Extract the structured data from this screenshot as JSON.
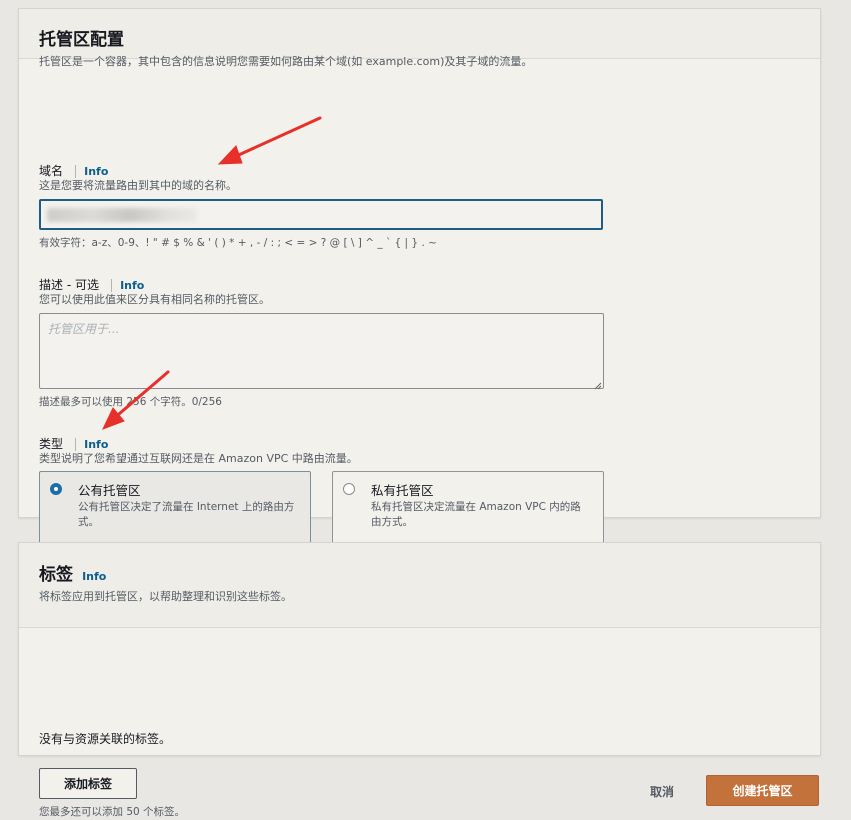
{
  "hosted_zone": {
    "title": "托管区配置",
    "description": "托管区是一个容器，其中包含的信息说明您需要如何路由某个域(如 example.com)及其子域的流量。",
    "domain": {
      "label": "域名",
      "info": "Info",
      "description": "这是您要将流量路由到其中的域的名称。",
      "valid_chars": "有效字符：a-z、0-9、! \" # $ % & ' ( ) * + , - / : ; < = > ? @ [ \\ ] ^ _ ` { | } . ~"
    },
    "description_field": {
      "label": "描述 - ",
      "optional": "可选",
      "info": "Info",
      "description": "您可以使用此值来区分具有相同名称的托管区。",
      "placeholder": "托管区用于...",
      "hint": "描述最多可以使用 256 个字符。0/256"
    },
    "type": {
      "label": "类型",
      "info": "Info",
      "description": "类型说明了您希望通过互联网还是在 Amazon VPC 中路由流量。",
      "options": [
        {
          "title": "公有托管区",
          "desc": "公有托管区决定了流量在 Internet 上的路由方式。",
          "selected": true
        },
        {
          "title": "私有托管区",
          "desc": "私有托管区决定流量在 Amazon VPC 内的路由方式。",
          "selected": false
        }
      ]
    }
  },
  "tags": {
    "title": "标签",
    "info": "Info",
    "description": "将标签应用到托管区，以帮助整理和识别这些标签。",
    "empty": "没有与资源关联的标签。",
    "add_button": "添加标签",
    "hint": "您最多还可以添加 50 个标签。"
  },
  "footer": {
    "cancel": "取消",
    "create": "创建托管区"
  },
  "colors": {
    "primary": "#c4723b",
    "link": "#0b5e8f",
    "focus": "#1e5e83",
    "annotation_arrow": "#e8302b"
  }
}
